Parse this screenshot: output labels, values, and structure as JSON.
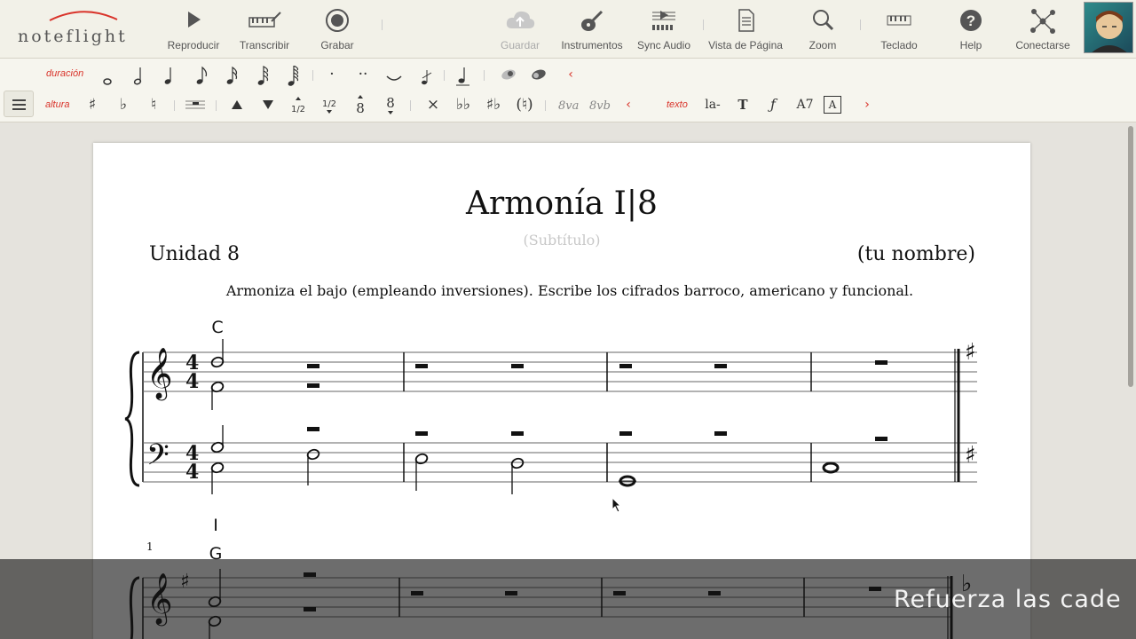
{
  "app": {
    "logo_text": "noteflight",
    "accent_color": "#d9342b"
  },
  "toolbar": {
    "items": [
      {
        "label": "Reproducir",
        "icon": "play-icon"
      },
      {
        "label": "Transcribir",
        "icon": "keyboard-pen-icon"
      },
      {
        "label": "Grabar",
        "icon": "record-icon"
      },
      {
        "label": "Guardar",
        "icon": "cloud-save-icon",
        "disabled": true
      },
      {
        "label": "Instrumentos",
        "icon": "guitar-icon"
      },
      {
        "label": "Sync Audio",
        "icon": "sync-audio-icon"
      },
      {
        "label": "Vista de Página",
        "icon": "page-view-icon"
      },
      {
        "label": "Zoom",
        "icon": "zoom-icon"
      },
      {
        "label": "Teclado",
        "icon": "piano-keyboard-icon"
      },
      {
        "label": "Help",
        "icon": "help-icon"
      },
      {
        "label": "Conectarse",
        "icon": "connect-icon"
      }
    ],
    "avatar_icon": "user-avatar"
  },
  "palette": {
    "duration_label": "duración",
    "pitch_label": "altura",
    "text_label": "texto",
    "half_label": "1/2",
    "ottava_up": "8va",
    "ottava_down": "8vb",
    "lyric_label": "la-",
    "chord_label": "A7",
    "textbox_label": "A"
  },
  "score": {
    "title": "Armonía I|8",
    "subtitle_placeholder": "(Subtítulo)",
    "unit": "Unidad 8",
    "composer_placeholder": "(tu nombre)",
    "instructions": "Armoniza el bajo (empleando inversiones). Escribe los cifrados barroco, americano y funcional.",
    "time_signature": "4/4",
    "system1_chord": "C",
    "system1_function": "I",
    "system2_measure_number": "1",
    "system2_chord": "G"
  },
  "caption": {
    "text": "Refuerza las cade"
  }
}
